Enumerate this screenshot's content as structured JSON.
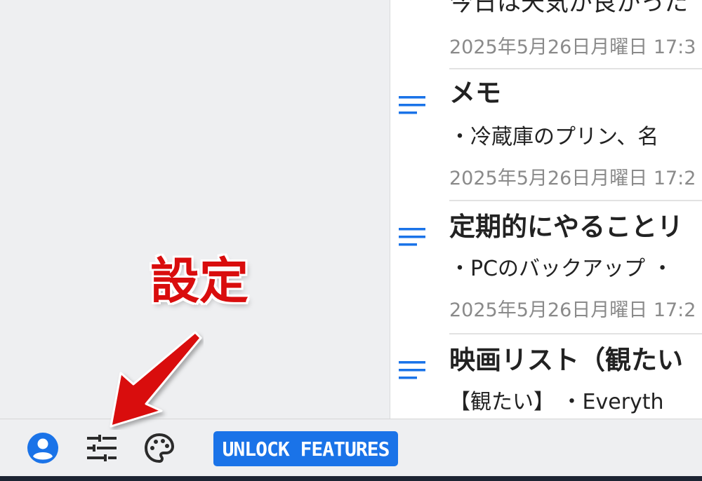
{
  "notes": [
    {
      "title": "今日は天気が良かった",
      "snippet": "",
      "date": "2025年5月26日月曜日 17:3"
    },
    {
      "title": "メモ",
      "snippet": "・冷蔵庫のプリン、名",
      "date": "2025年5月26日月曜日 17:2"
    },
    {
      "title": "定期的にやることリ",
      "snippet": "・PCのバックアップ ・",
      "date": "2025年5月26日月曜日 17:2"
    },
    {
      "title": "映画リスト（観たい",
      "snippet": "【観たい】 ・Everyth",
      "date": ""
    }
  ],
  "bottom_bar": {
    "unlock_label": "UNLOCK FEATURES",
    "icons": [
      "account-icon",
      "settings-sliders-icon",
      "palette-icon"
    ]
  },
  "annotation": {
    "label": "設定"
  },
  "colors": {
    "accent": "#1a73e8",
    "annotation_red": "#d90d0d",
    "bottom_strip": "#1c2433"
  }
}
